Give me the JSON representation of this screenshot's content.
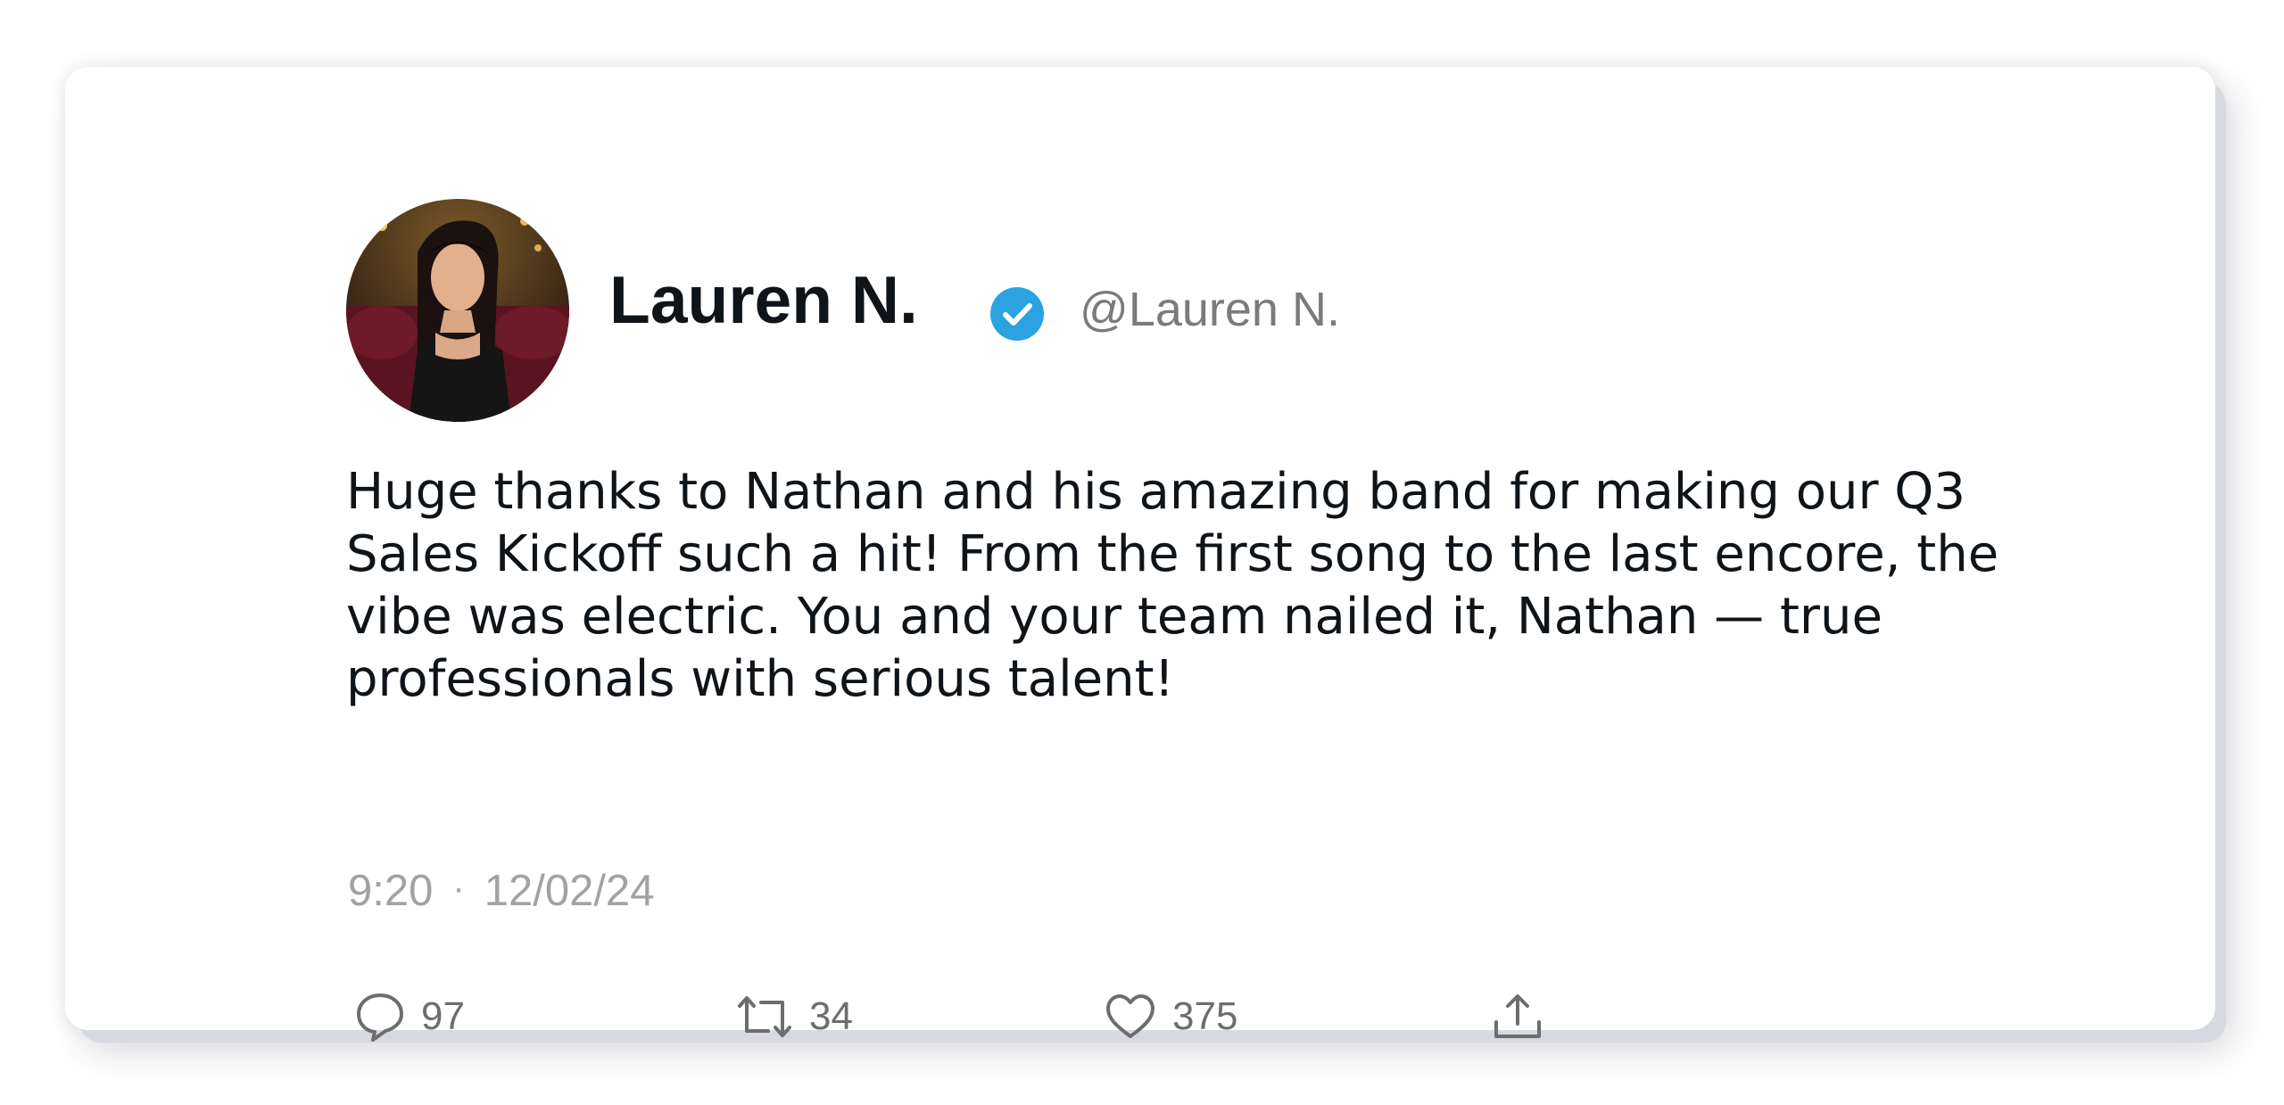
{
  "tweet": {
    "display_name": "Lauren N.",
    "handle": "@Lauren N.",
    "verified_icon": "verified-badge-icon",
    "avatar_description": "avatar",
    "text": "Huge thanks to Nathan and his amazing band for making our Q3 Sales Kickoff such a hit! From the first song to the last encore, the vibe was electric. You and your team nailed it, Nathan — true professionals with serious talent!",
    "time": "9:20",
    "separator": "·",
    "date": "12/02/24"
  },
  "actions": {
    "reply": {
      "icon": "reply-icon",
      "count": "97"
    },
    "retweet": {
      "icon": "retweet-icon",
      "count": "34"
    },
    "like": {
      "icon": "heart-icon",
      "count": "375"
    },
    "share": {
      "icon": "share-icon"
    }
  },
  "colors": {
    "verified": "#2aa3e0",
    "text": "#0f1419",
    "muted": "#7b7b7b",
    "icon": "#6d6d6d"
  }
}
